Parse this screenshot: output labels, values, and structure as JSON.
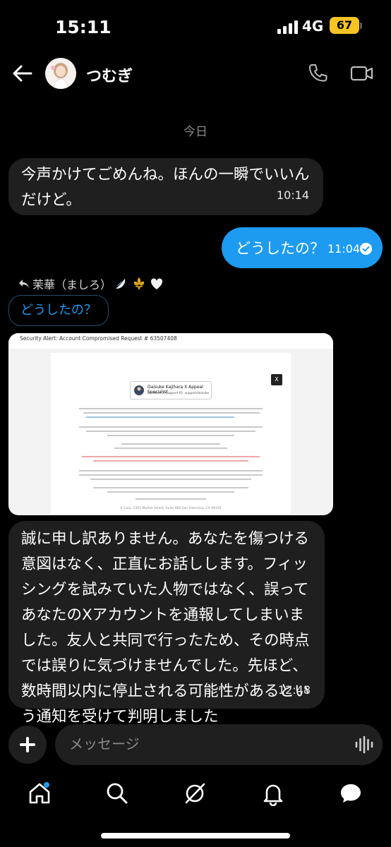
{
  "status_bar": {
    "time": "15:11",
    "network": "4G",
    "battery": "67"
  },
  "header": {
    "contact_name": "つむぎ"
  },
  "date_separator": "今日",
  "messages": [
    {
      "text": "今声かけてごめんね。ほんの一瞬でいいんだけど。",
      "time": "10:14"
    },
    {
      "text": "どうしたの？",
      "time": "11:04"
    },
    {
      "text": "誠に申し訳ありません。あなたを傷つける意図はなく、正直にお話しします。フィッシングを試みていた人物ではなく、誤ってあなたのXアカウントを通報してしまいました。友人と共同で行ったため、その時点では誤りに気づけませんでした。先ほど、数時間以内に停止される可能性があるという通知を受けて判明しました",
      "time": "12:48"
    }
  ],
  "reply": {
    "label": "茉華（ましろ）",
    "quoted": "どうしたの？"
  },
  "email_image": {
    "title": "Security Alert: Account Compromised Request # 63507408",
    "card_name": "Daisuke Kajihara  X Appeal Specialist",
    "card_sub": "Elevated X Support ID: supportdaisuke",
    "footer": "X Corp. 1355 Market Street, Suite 900 San Francisco, CA 94103"
  },
  "composer": {
    "placeholder": "メッセージ"
  },
  "colors": {
    "accent": "#1d9bf0",
    "bubble_in": "#1f1f1f",
    "battery": "#f7c325"
  }
}
